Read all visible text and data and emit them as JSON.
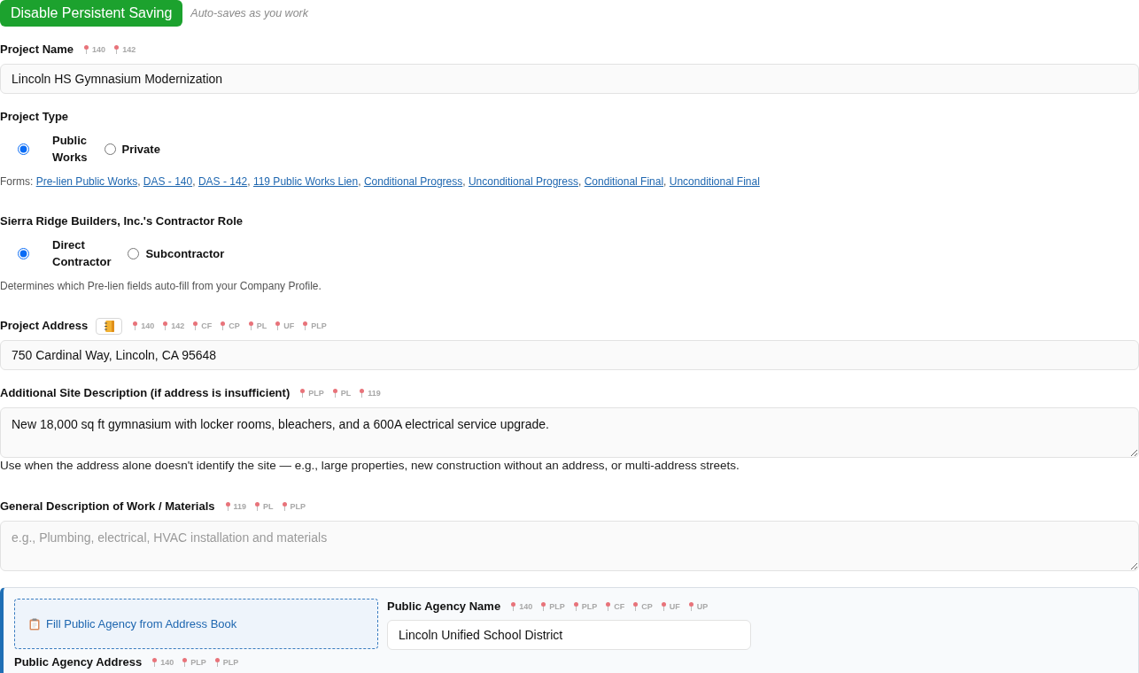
{
  "save_bar": {
    "button": "Disable Persistent Saving",
    "status": "Auto-saves as you work"
  },
  "project_name": {
    "label": "Project Name",
    "pins": [
      "140",
      "142"
    ],
    "value": "Lincoln HS Gymnasium Modernization"
  },
  "project_type": {
    "label": "Project Type",
    "options": [
      {
        "label": "Public Works",
        "selected": true
      },
      {
        "label": "Private",
        "selected": false
      }
    ],
    "forms": {
      "label": "Forms:",
      "separator": ", ",
      "links": [
        "Pre-lien Public Works",
        "DAS - 140",
        "DAS - 142",
        "119 Public Works Lien",
        "Conditional Progress",
        "Unconditional Progress",
        "Conditional Final",
        "Unconditional Final"
      ]
    }
  },
  "contractor_role": {
    "label": "Sierra Ridge Builders, Inc.'s Contractor Role",
    "options": [
      {
        "label": "Direct Contractor",
        "selected": true
      },
      {
        "label": "Subcontractor",
        "selected": false
      }
    ],
    "help": "Determines which Pre-lien fields auto-fill from your Company Profile."
  },
  "project_address": {
    "label": "Project Address",
    "pins": [
      "140",
      "142",
      "CF",
      "CP",
      "PL",
      "UF",
      "PLP"
    ],
    "value": "750 Cardinal Way, Lincoln, CA 95648"
  },
  "site_description": {
    "label": "Additional Site Description (if address is insufficient)",
    "pins": [
      "PLP",
      "PL",
      "119"
    ],
    "value": "New 18,000 sq ft gymnasium with locker rooms, bleachers, and a 600A electrical service upgrade.",
    "help": "Use when the address alone doesn't identify the site — e.g., large properties, new construction without an address, or multi-address streets."
  },
  "work_description": {
    "label": "General Description of Work / Materials",
    "pins": [
      "119",
      "PL",
      "PLP"
    ],
    "placeholder": "e.g., Plumbing, electrical, HVAC installation and materials"
  },
  "public_agency": {
    "fill_button": "Fill Public Agency from Address Book",
    "name_field": {
      "label": "Public Agency Name",
      "pins": [
        "140",
        "PLP",
        "PLP",
        "CF",
        "CP",
        "UF",
        "UP"
      ],
      "value": "Lincoln Unified School District"
    },
    "address_field": {
      "label": "Public Agency Address",
      "pins": [
        "140",
        "PLP",
        "PLP"
      ]
    }
  }
}
